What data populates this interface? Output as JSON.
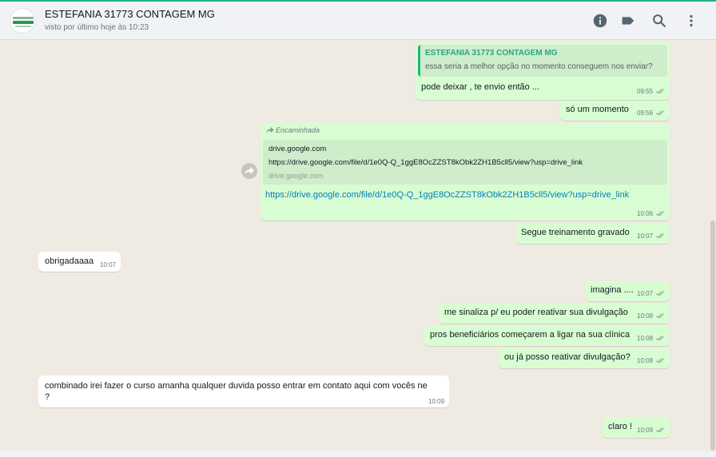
{
  "header": {
    "contact_name": "ESTEFANIA 31773 CONTAGEM MG",
    "last_seen": "visto por último hoje às 10:23",
    "icons": [
      "info-icon",
      "label-icon",
      "search-icon",
      "menu-icon"
    ]
  },
  "messages": {
    "m1": {
      "quote_author": "ESTEFANIA 31773 CONTAGEM MG",
      "quote_text": "essa seria a melhor opção no momento conseguem nos enviar?",
      "text": "pode deixar , te envio então ...",
      "time": "09:55"
    },
    "m2": {
      "text": "só um momento",
      "time": "09:56"
    },
    "m3": {
      "forwarded_label": "Encaminhada",
      "preview_title": "drive.google.com",
      "preview_desc": "https://drive.google.com/file/d/1e0Q-Q_1ggE8OcZZST8kObk2ZH1B5cll5/view?usp=drive_link",
      "preview_domain": "drive.google.com",
      "link": "https://drive.google.com/file/d/1e0Q-Q_1ggE8OcZZST8kObk2ZH1B5cll5/view?usp=drive_link",
      "time": "10:06"
    },
    "m4": {
      "text": "Segue treinamento gravado",
      "time": "10:07"
    },
    "m5": {
      "text": "obrigadaaaa",
      "time": "10:07"
    },
    "m6": {
      "text": "imagina ....",
      "time": "10:07"
    },
    "m7": {
      "text": "me sinaliza p/ eu poder reativar sua divulgação",
      "time": "10:08"
    },
    "m8": {
      "text": "pros beneficiários começarem a ligar na sua clínica",
      "time": "10:08"
    },
    "m9": {
      "text": "ou já posso reativar divulgação?",
      "time": "10:08"
    },
    "m10": {
      "line1": "combinado irei fazer o curso amanha qualquer duvida posso entrar em contato aqui com vocês ne",
      "line2": "?",
      "time": "10:09"
    },
    "m11": {
      "text": "claro !",
      "time": "10:09"
    }
  },
  "colors": {
    "outgoing_bubble": "#d9fdd3",
    "incoming_bubble": "#ffffff",
    "chat_background": "#efeae2",
    "accent": "#25b08a",
    "link": "#027eb5"
  }
}
